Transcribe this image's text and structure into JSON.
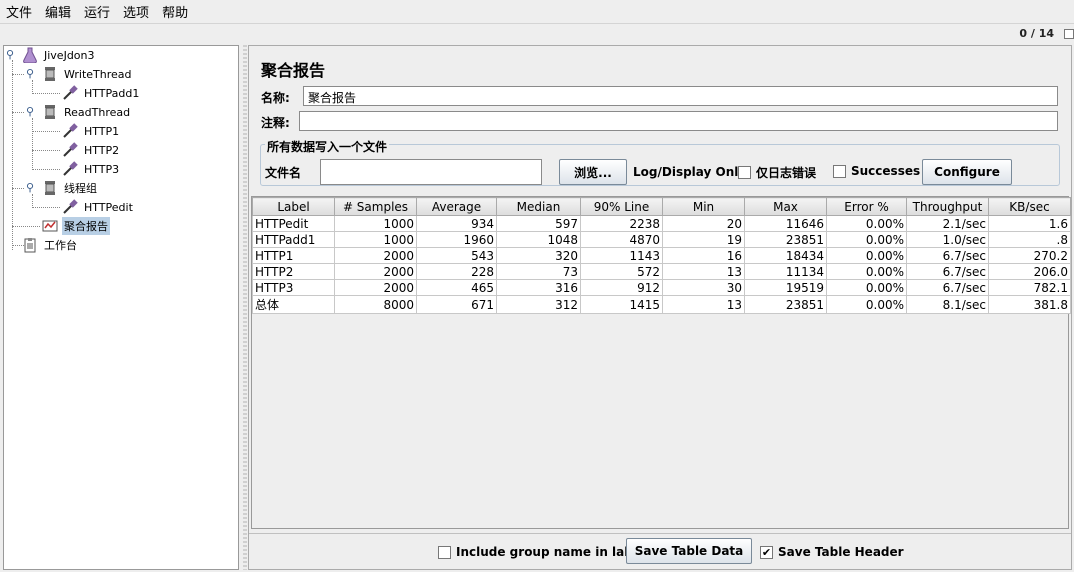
{
  "menu": [
    "文件",
    "编辑",
    "运行",
    "选项",
    "帮助"
  ],
  "toolbar": {
    "counter": "0 / 14"
  },
  "tree": {
    "root": "JiveJdon3",
    "write_thread": "WriteThread",
    "httpadd1": "HTTPadd1",
    "read_thread": "ReadThread",
    "http1": "HTTP1",
    "http2": "HTTP2",
    "http3": "HTTP3",
    "thread_group": "线程组",
    "httpedit": "HTTPedit",
    "aggregate_report": "聚合报告",
    "workbench": "工作台"
  },
  "panel": {
    "title": "聚合报告",
    "name_label": "名称:",
    "name_value": "聚合报告",
    "comment_label": "注释:",
    "comment_value": "",
    "file_section_title": "所有数据写入一个文件",
    "filename_label": "文件名",
    "filename_value": "",
    "browse_button": "浏览...",
    "log_display_label": "Log/Display Only:",
    "errors_only_label": "仅日志错误",
    "successes_label": "Successes",
    "configure_button": "Configure"
  },
  "table": {
    "headers": [
      "Label",
      "# Samples",
      "Average",
      "Median",
      "90% Line",
      "Min",
      "Max",
      "Error %",
      "Throughput",
      "KB/sec"
    ],
    "rows": [
      [
        "HTTPedit",
        "1000",
        "934",
        "597",
        "2238",
        "20",
        "11646",
        "0.00%",
        "2.1/sec",
        "1.6"
      ],
      [
        "HTTPadd1",
        "1000",
        "1960",
        "1048",
        "4870",
        "19",
        "23851",
        "0.00%",
        "1.0/sec",
        ".8"
      ],
      [
        "HTTP1",
        "2000",
        "543",
        "320",
        "1143",
        "16",
        "18434",
        "0.00%",
        "6.7/sec",
        "270.2"
      ],
      [
        "HTTP2",
        "2000",
        "228",
        "73",
        "572",
        "13",
        "11134",
        "0.00%",
        "6.7/sec",
        "206.0"
      ],
      [
        "HTTP3",
        "2000",
        "465",
        "316",
        "912",
        "30",
        "19519",
        "0.00%",
        "6.7/sec",
        "782.1"
      ],
      [
        "总体",
        "8000",
        "671",
        "312",
        "1415",
        "13",
        "23851",
        "0.00%",
        "8.1/sec",
        "381.8"
      ]
    ]
  },
  "bottom": {
    "include_group_label": "Include group name in label?",
    "include_group_checked": false,
    "save_table_data_button": "Save Table Data",
    "save_table_header_label": "Save Table Header",
    "save_table_header_checked": true,
    "check_mark": "✔"
  }
}
